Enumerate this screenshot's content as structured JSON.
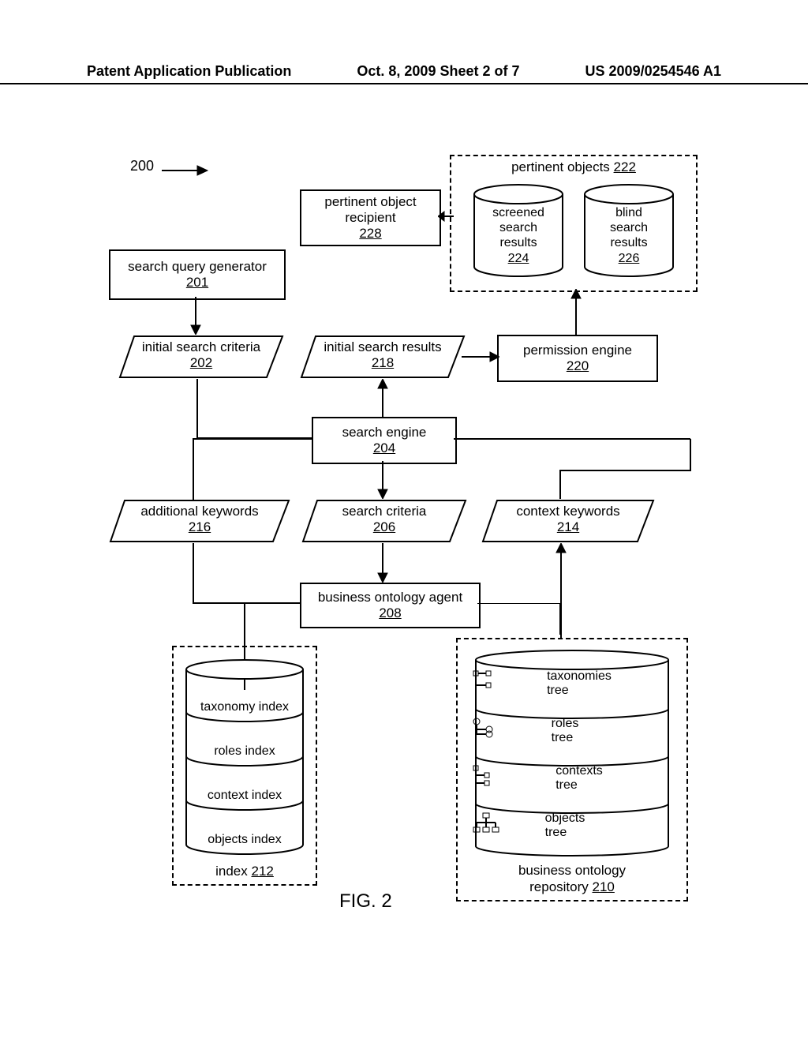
{
  "header": {
    "left": "Patent Application Publication",
    "mid": "Oct. 8, 2009  Sheet 2 of 7",
    "right": "US 2009/0254546 A1"
  },
  "figure_label": "FIG. 2",
  "ref_200": "200",
  "boxes": {
    "b201": {
      "label": "search query generator",
      "num": "201"
    },
    "b228": {
      "label": "pertinent object recipient",
      "num": "228"
    },
    "b220": {
      "label": "permission engine",
      "num": "220"
    },
    "b204": {
      "label": "search engine",
      "num": "204"
    },
    "b208": {
      "label": "business ontology agent",
      "num": "208"
    }
  },
  "paras": {
    "p202": {
      "label": "initial search criteria",
      "num": "202"
    },
    "p218": {
      "label": "initial search results",
      "num": "218"
    },
    "p216": {
      "label": "additional keywords",
      "num": "216"
    },
    "p206": {
      "label": "search criteria",
      "num": "206"
    },
    "p214": {
      "label": "context keywords",
      "num": "214"
    }
  },
  "pertinent_group": {
    "title": "pertinent objects",
    "title_num": "222",
    "screened": {
      "l1": "screened",
      "l2": "search",
      "l3": "results",
      "num": "224"
    },
    "blind": {
      "l1": "blind",
      "l2": "search",
      "l3": "results",
      "num": "226"
    }
  },
  "index_group": {
    "taxonomy": "taxonomy index",
    "roles": "roles index",
    "context": "context index",
    "objects": "objects index",
    "caption": "index",
    "caption_num": "212"
  },
  "ontology_group": {
    "taxonomies": {
      "l1": "taxonomies",
      "l2": "tree"
    },
    "roles": {
      "l1": "roles",
      "l2": "tree"
    },
    "contexts": {
      "l1": "contexts",
      "l2": "tree"
    },
    "objects": {
      "l1": "objects",
      "l2": "tree"
    },
    "caption": "business ontology repository",
    "caption_num": "210"
  }
}
